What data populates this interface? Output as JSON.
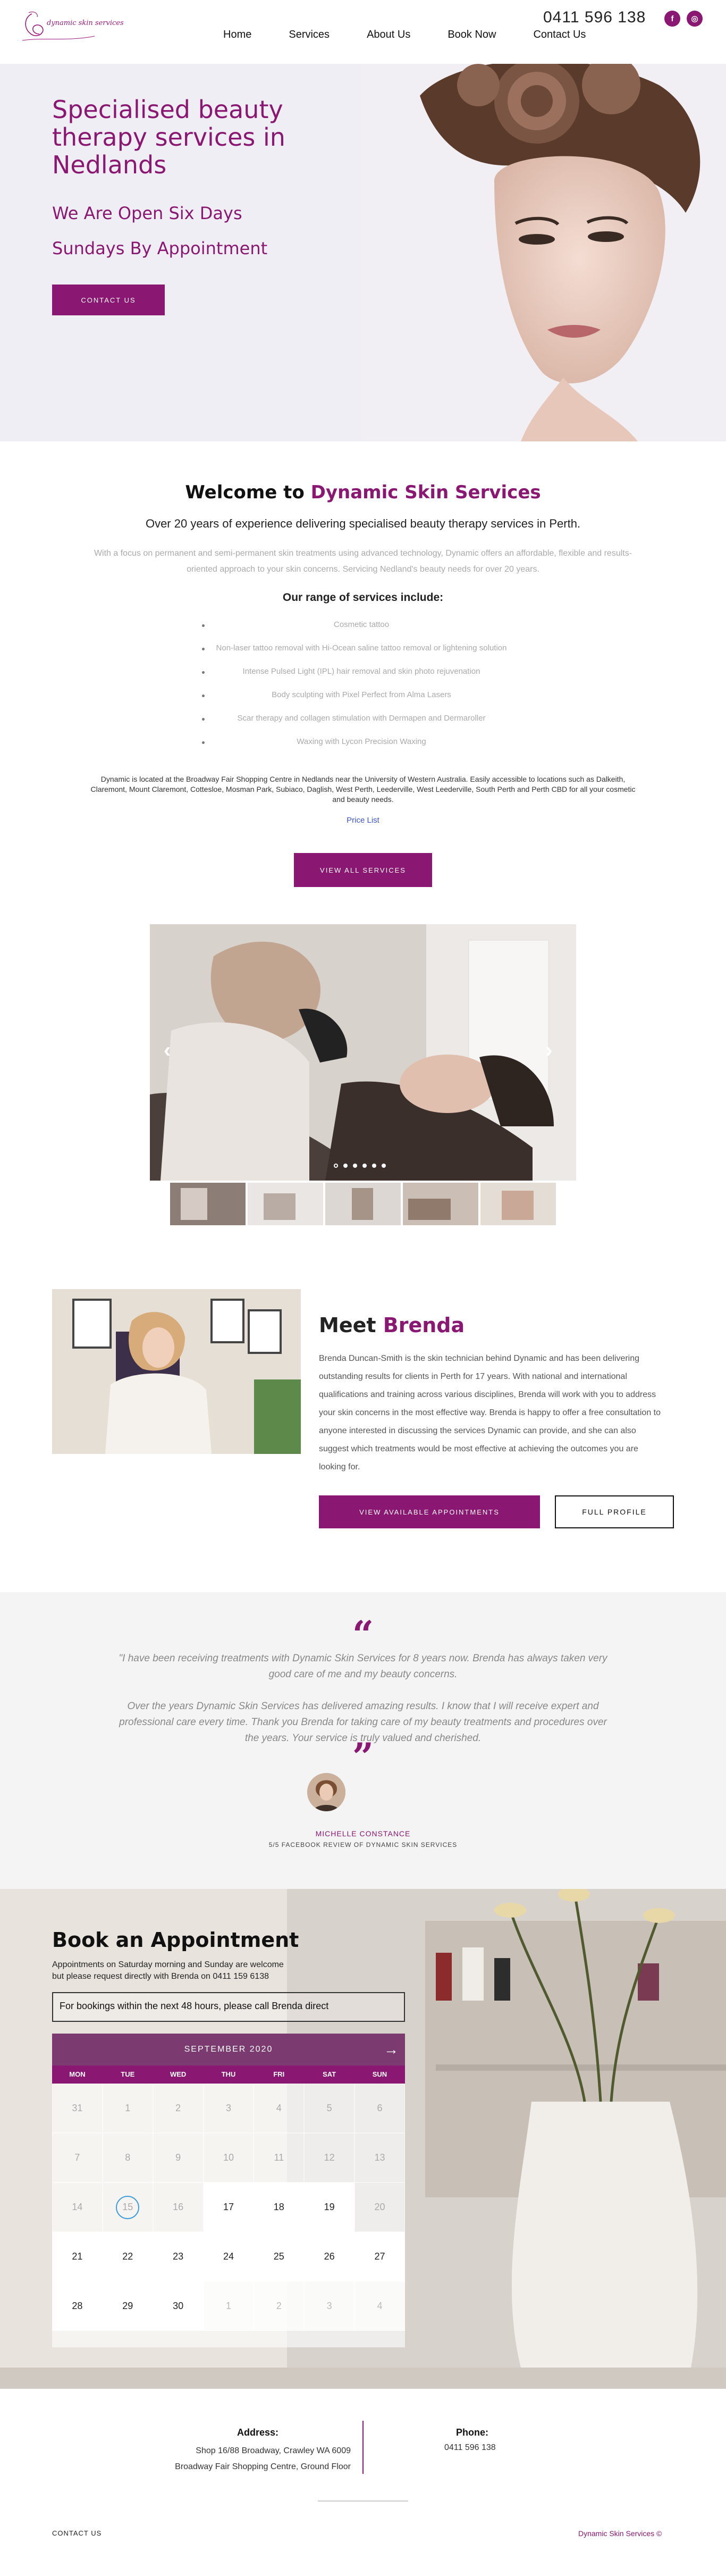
{
  "brand": {
    "logo_text": "dynamic skin services",
    "accent": "#8a1771"
  },
  "nav": {
    "items": [
      "Home",
      "Services",
      "About Us",
      "Book Now",
      "Contact Us"
    ]
  },
  "header": {
    "phone": "0411 596 138",
    "social": [
      {
        "name": "facebook-icon",
        "glyph": "f"
      },
      {
        "name": "instagram-icon",
        "glyph": "◎"
      }
    ]
  },
  "hero": {
    "title": "Specialised beauty therapy services in Nedlands",
    "line1": "We Are Open Six Days",
    "line2": "Sundays By Appointment",
    "button": "CONTACT US"
  },
  "welcome": {
    "title_prefix": "Welcome to ",
    "title_highlight": "Dynamic Skin Services",
    "lead": "Over 20 years of experience delivering specialised beauty therapy services in Perth.",
    "desc": "With a focus on permanent and semi-permanent skin treatments using advanced technology, Dynamic offers an affordable, flexible and results-oriented approach to your skin concerns. Servicing Nedland's beauty needs for over 20 years.",
    "range_title": "Our range of services include:",
    "services": [
      "Cosmetic tattoo",
      "Non-laser tattoo removal with Hi-Ocean saline tattoo removal or lightening solution",
      "Intense Pulsed Light (IPL) hair removal and skin photo rejuvenation",
      "Body sculpting with Pixel Perfect from Alma Lasers",
      "Scar therapy and collagen stimulation with Dermapen and Dermaroller",
      "Waxing with Lycon Precision Waxing"
    ],
    "location": "Dynamic is located at the Broadway Fair Shopping Centre in Nedlands near the University of Western Australia. Easily accessible to locations such as Dalkeith, Claremont, Mount Claremont, Cottesloe, Mosman Park, Subiaco, Daglish, West Perth, Leederville, West Leederville, South Perth and Perth CBD for all your cosmetic and beauty needs.",
    "price_link": "Price List",
    "button": "VIEW ALL SERVICES"
  },
  "meet": {
    "title_prefix": "Meet ",
    "title_highlight": "Brenda",
    "text": "Brenda Duncan-Smith is the skin technician behind Dynamic and has been delivering outstanding results for clients in Perth for 17 years. With national and international qualifications and training across various disciplines, Brenda will work with you to address your skin concerns in the most effective way. Brenda is happy to offer a free consultation to anyone interested in discussing the services Dynamic can provide, and she can also suggest which treatments would be most effective at achieving the outcomes you are looking for.",
    "appt_button": "VIEW AVAILABLE APPOINTMENTS",
    "profile_button": "FULL PROFILE"
  },
  "testimonial": {
    "p1": "\"I have been receiving treatments with Dynamic Skin Services for 8 years now. Brenda has always taken very good care of me and my beauty concerns.",
    "p2": "Over the years Dynamic Skin Services has delivered amazing results. I know that I will receive expert and professional care every time. Thank you Brenda for taking care of my beauty treatments and procedures over the years. Your service is truly valued and cherished.",
    "name": "MICHELLE CONSTANCE",
    "source": "5/5 FACEBOOK REVIEW OF DYNAMIC SKIN SERVICES"
  },
  "booking": {
    "title": "Book an Appointment",
    "note1": "Appointments on Saturday morning and Sunday are welcome",
    "note2": "but please request directly with Brenda on 0411 159 6138",
    "box": "For bookings within the next 48 hours, please call Brenda direct",
    "month": "SEPTEMBER 2020",
    "days": [
      "MON",
      "TUE",
      "WED",
      "THU",
      "FRI",
      "SAT",
      "SUN"
    ],
    "weeks": [
      [
        "31",
        "1",
        "2",
        "3",
        "4",
        "5",
        "6"
      ],
      [
        "7",
        "8",
        "9",
        "10",
        "11",
        "12",
        "13"
      ],
      [
        "14",
        "15",
        "16",
        "17",
        "18",
        "19",
        "20"
      ],
      [
        "21",
        "22",
        "23",
        "24",
        "25",
        "26",
        "27"
      ],
      [
        "28",
        "29",
        "30",
        "1",
        "2",
        "3",
        "4"
      ]
    ],
    "today": "15"
  },
  "footer": {
    "address_label": "Address:",
    "address_lines": [
      "Shop 16/88 Broadway, Crawley WA 6009",
      "Broadway Fair Shopping Centre, Ground Floor"
    ],
    "phone_label": "Phone:",
    "phone": "0411 596 138",
    "left": "CONTACT US",
    "right": "Dynamic Skin Services ©"
  }
}
